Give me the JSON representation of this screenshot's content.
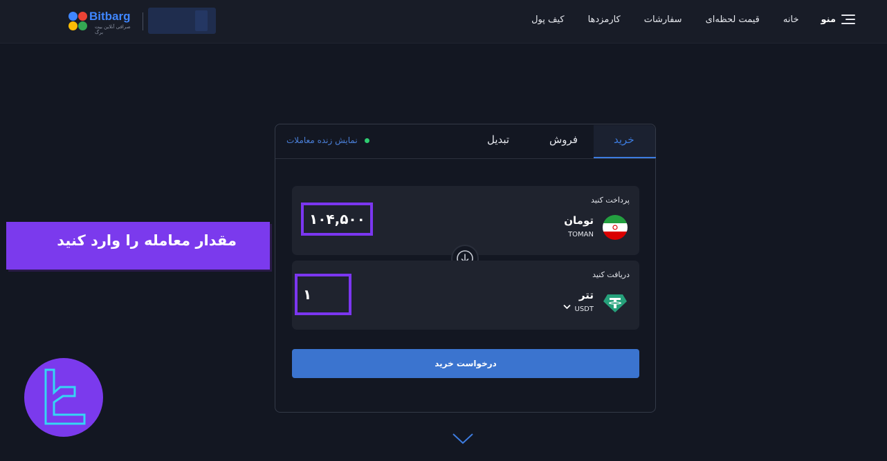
{
  "header": {
    "logo_text": "Bitbarg",
    "logo_subtitle": "صرافی آنلاین بیت برگ",
    "menu_label": "منو",
    "nav_items": [
      "خانه",
      "قیمت لحظه‌ای",
      "سفارشات",
      "کارمزدها",
      "کیف پول"
    ]
  },
  "trade": {
    "tabs": [
      "خرید",
      "فروش",
      "تبدیل"
    ],
    "active_tab": "خرید",
    "live_link": "نمایش زنده معاملات",
    "pay": {
      "label": "پرداخت کنید",
      "currency_name": "تومان",
      "currency_code": "TOMAN",
      "amount": "۱۰۴,۵۰۰"
    },
    "receive": {
      "label": "دریافت کنید",
      "currency_name": "تتر",
      "currency_code": "USDT",
      "amount": "۱"
    },
    "submit_label": "درخواست خرید"
  },
  "overlay": {
    "instruction": "مقدار معامله را وارد کنید"
  },
  "colors": {
    "accent": "#3d7ce0",
    "highlight": "#7b36f0",
    "live_dot": "#2ecc71",
    "tether": "#26a17b"
  }
}
